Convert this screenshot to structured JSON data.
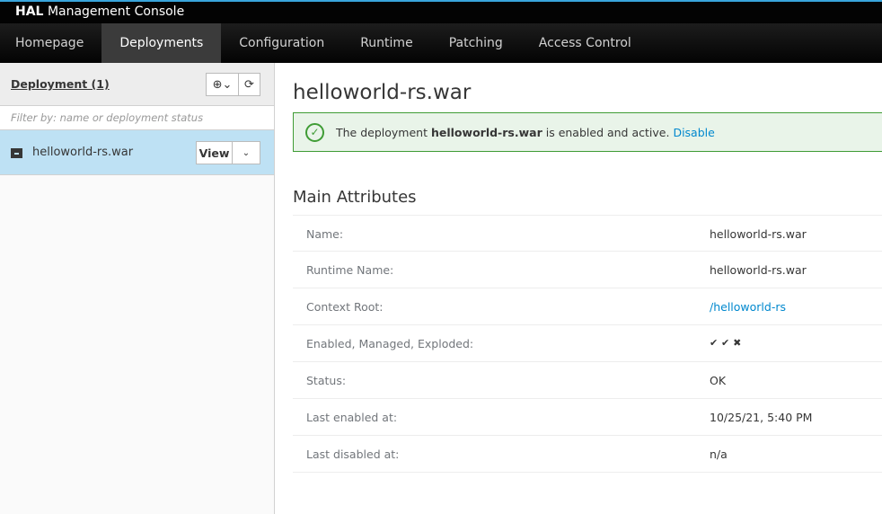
{
  "app": {
    "brand_bold": "HAL",
    "brand_rest": "Management Console"
  },
  "nav": [
    {
      "label": "Homepage"
    },
    {
      "label": "Deployments",
      "active": true
    },
    {
      "label": "Configuration"
    },
    {
      "label": "Runtime"
    },
    {
      "label": "Patching"
    },
    {
      "label": "Access Control"
    }
  ],
  "sidebar": {
    "title": "Deployment (1)",
    "add_icon": "⊕⌄",
    "refresh_icon": "⟳",
    "filter_placeholder": "Filter by: name or deployment status",
    "item": {
      "name": "helloworld-rs.war",
      "view_label": "View",
      "dropdown": "⌄"
    }
  },
  "main": {
    "title": "helloworld-rs.war",
    "alert": {
      "prefix": "The deployment",
      "name": "helloworld-rs.war",
      "suffix": "is enabled and active.",
      "action": "Disable",
      "color": "#3f9c35"
    },
    "section": "Main Attributes",
    "attributes": [
      {
        "label": "Name:",
        "value": "helloworld-rs.war"
      },
      {
        "label": "Runtime Name:",
        "value": "helloworld-rs.war"
      },
      {
        "label": "Context Root:",
        "value": "/helloworld-rs"
      },
      {
        "label": "Enabled, Managed, Exploded:",
        "value": "✔ ✔ ✖"
      },
      {
        "label": "Status:",
        "value": "OK"
      },
      {
        "label": "Last enabled at:",
        "value": "10/25/21, 5:40 PM"
      },
      {
        "label": "Last disabled at:",
        "value": "n/a"
      }
    ]
  }
}
